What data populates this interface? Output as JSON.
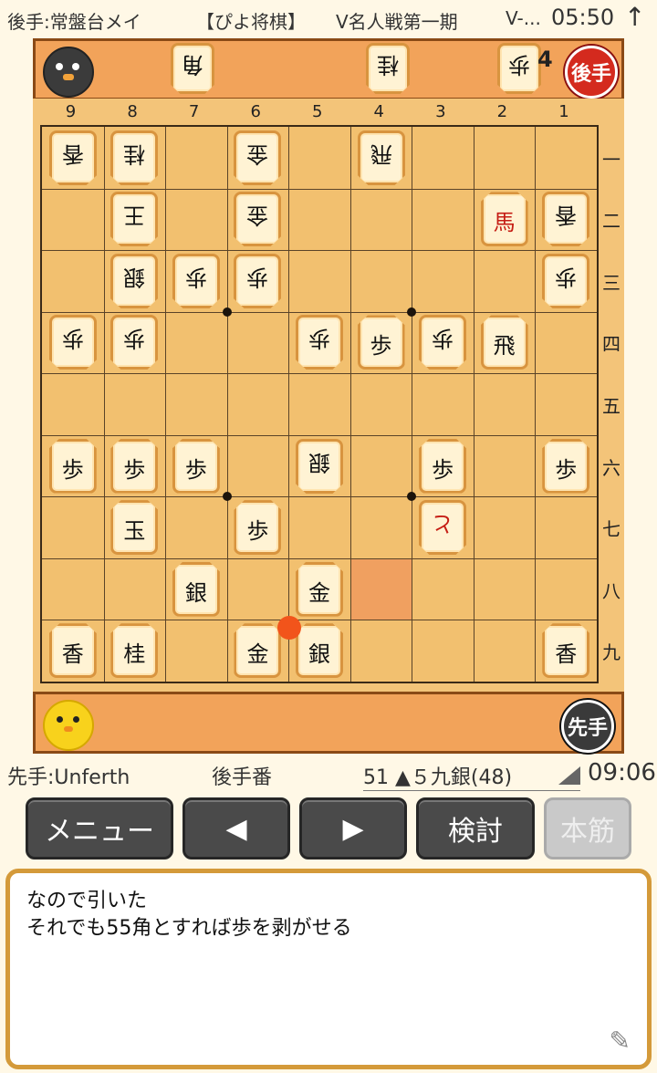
{
  "top_bar": {
    "gote_name": "後手:常盤台メイ",
    "app_tag": "【ぴよ将棋】",
    "event": "V名人戦第一期",
    "trunc": "V-...",
    "time": "05:50",
    "sort_icon": "up-arrow-icon"
  },
  "gote_hand": {
    "pieces": [
      "角",
      "桂",
      "歩"
    ],
    "pawn_count": "4",
    "badge": "後手",
    "avatar": "gray-bird-icon"
  },
  "sente_hand": {
    "badge": "先手",
    "avatar": "yellow-chick-icon"
  },
  "file_labels": [
    "9",
    "8",
    "7",
    "6",
    "5",
    "4",
    "3",
    "2",
    "1"
  ],
  "rank_labels": [
    "一",
    "二",
    "三",
    "四",
    "五",
    "六",
    "七",
    "八",
    "九"
  ],
  "pieces": [
    {
      "f": 9,
      "r": 1,
      "k": "香",
      "s": "gote"
    },
    {
      "f": 8,
      "r": 1,
      "k": "桂",
      "s": "gote"
    },
    {
      "f": 6,
      "r": 1,
      "k": "金",
      "s": "gote"
    },
    {
      "f": 4,
      "r": 1,
      "k": "飛",
      "s": "gote"
    },
    {
      "f": 8,
      "r": 2,
      "k": "王",
      "s": "gote"
    },
    {
      "f": 6,
      "r": 2,
      "k": "金",
      "s": "gote"
    },
    {
      "f": 2,
      "r": 2,
      "k": "馬",
      "s": "sente",
      "p": true
    },
    {
      "f": 1,
      "r": 2,
      "k": "香",
      "s": "gote"
    },
    {
      "f": 8,
      "r": 3,
      "k": "銀",
      "s": "gote"
    },
    {
      "f": 7,
      "r": 3,
      "k": "歩",
      "s": "gote"
    },
    {
      "f": 6,
      "r": 3,
      "k": "歩",
      "s": "gote"
    },
    {
      "f": 1,
      "r": 3,
      "k": "歩",
      "s": "gote"
    },
    {
      "f": 9,
      "r": 4,
      "k": "歩",
      "s": "gote"
    },
    {
      "f": 8,
      "r": 4,
      "k": "歩",
      "s": "gote"
    },
    {
      "f": 5,
      "r": 4,
      "k": "歩",
      "s": "gote"
    },
    {
      "f": 4,
      "r": 4,
      "k": "歩",
      "s": "sente"
    },
    {
      "f": 3,
      "r": 4,
      "k": "歩",
      "s": "gote"
    },
    {
      "f": 2,
      "r": 4,
      "k": "飛",
      "s": "sente"
    },
    {
      "f": 9,
      "r": 6,
      "k": "歩",
      "s": "sente"
    },
    {
      "f": 8,
      "r": 6,
      "k": "歩",
      "s": "sente"
    },
    {
      "f": 7,
      "r": 6,
      "k": "歩",
      "s": "sente"
    },
    {
      "f": 5,
      "r": 6,
      "k": "銀",
      "s": "gote"
    },
    {
      "f": 3,
      "r": 6,
      "k": "歩",
      "s": "sente"
    },
    {
      "f": 1,
      "r": 6,
      "k": "歩",
      "s": "sente"
    },
    {
      "f": 8,
      "r": 7,
      "k": "玉",
      "s": "sente"
    },
    {
      "f": 6,
      "r": 7,
      "k": "歩",
      "s": "sente"
    },
    {
      "f": 3,
      "r": 7,
      "k": "と",
      "s": "gote",
      "p": true
    },
    {
      "f": 7,
      "r": 8,
      "k": "銀",
      "s": "sente"
    },
    {
      "f": 5,
      "r": 8,
      "k": "金",
      "s": "sente"
    },
    {
      "f": 9,
      "r": 9,
      "k": "香",
      "s": "sente"
    },
    {
      "f": 8,
      "r": 9,
      "k": "桂",
      "s": "sente"
    },
    {
      "f": 6,
      "r": 9,
      "k": "金",
      "s": "sente"
    },
    {
      "f": 5,
      "r": 9,
      "k": "銀",
      "s": "sente"
    },
    {
      "f": 1,
      "r": 9,
      "k": "香",
      "s": "sente"
    }
  ],
  "highlight": {
    "f": 4,
    "r": 8
  },
  "status_bar": {
    "sente_name": "先手:Unferth",
    "turn": "後手番",
    "move": "51 ▲５九銀(48)",
    "clock": "09:06"
  },
  "buttons": {
    "menu": "メニュー",
    "prev": "◀",
    "next": "▶",
    "analyze": "検討",
    "mainline": "本筋"
  },
  "comment": {
    "line1": "なので引いた",
    "line2": "それでも55角とすれば歩を剥がせる",
    "edit_icon": "pencil-icon"
  },
  "colors": {
    "accent": "#f0964f",
    "promoted": "#c51d14",
    "highlight": "#f0a060",
    "last_move_dot": "#f2541b"
  }
}
